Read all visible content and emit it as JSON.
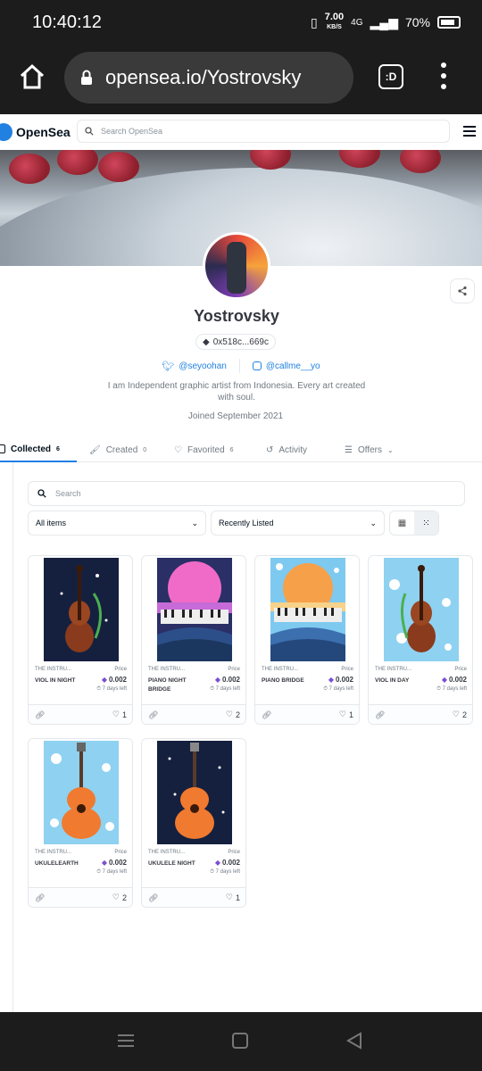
{
  "status": {
    "time": "10:40:12",
    "speed_value": "7.00",
    "speed_unit": "KB/S",
    "network": "4G",
    "battery": "70%"
  },
  "browser": {
    "url": "opensea.io/Yostrovsky",
    "tabs_label": ":D"
  },
  "header": {
    "logo": "OpenSea",
    "search_placeholder": "Search OpenSea"
  },
  "profile": {
    "name": "Yostrovsky",
    "address": "0x518c...669c",
    "twitter": "@seyoohan",
    "instagram": "@callme__yo",
    "bio": "I am Independent graphic artist from Indonesia. Every art created with soul.",
    "joined": "Joined September 2021"
  },
  "tabs": [
    {
      "label": "Collected",
      "count": "6"
    },
    {
      "label": "Created",
      "count": "0"
    },
    {
      "label": "Favorited",
      "count": "6"
    },
    {
      "label": "Activity",
      "count": ""
    },
    {
      "label": "Offers",
      "count": ""
    }
  ],
  "filters": {
    "search_placeholder": "Search",
    "items_select": "All items",
    "sort_select": "Recently Listed"
  },
  "cards": [
    {
      "collection": "THE INSTRU...",
      "name": "VIOL IN NIGHT",
      "price_label": "Price",
      "price": "0.002",
      "time_left": "7 days left",
      "favorites": "1"
    },
    {
      "collection": "THE INSTRU...",
      "name": "PIANO NIGHT BRIDGE",
      "price_label": "Price",
      "price": "0.002",
      "time_left": "7 days left",
      "favorites": "2"
    },
    {
      "collection": "THE INSTRU...",
      "name": "PIANO BRIDGE",
      "price_label": "Price",
      "price": "0.002",
      "time_left": "7 days left",
      "favorites": "1"
    },
    {
      "collection": "THE INSTRU...",
      "name": "VIOL IN DAY",
      "price_label": "Price",
      "price": "0.002",
      "time_left": "7 days left",
      "favorites": "2"
    },
    {
      "collection": "THE INSTRU...",
      "name": "UKULELEARTH",
      "price_label": "Price",
      "price": "0.002",
      "time_left": "7 days left",
      "favorites": "2"
    },
    {
      "collection": "THE INSTRU...",
      "name": "UKULELE NIGHT",
      "price_label": "Price",
      "price": "0.002",
      "time_left": "7 days left",
      "favorites": "1"
    }
  ],
  "colors": {
    "accent": "#2081e2",
    "eth": "#7b4fd2"
  }
}
